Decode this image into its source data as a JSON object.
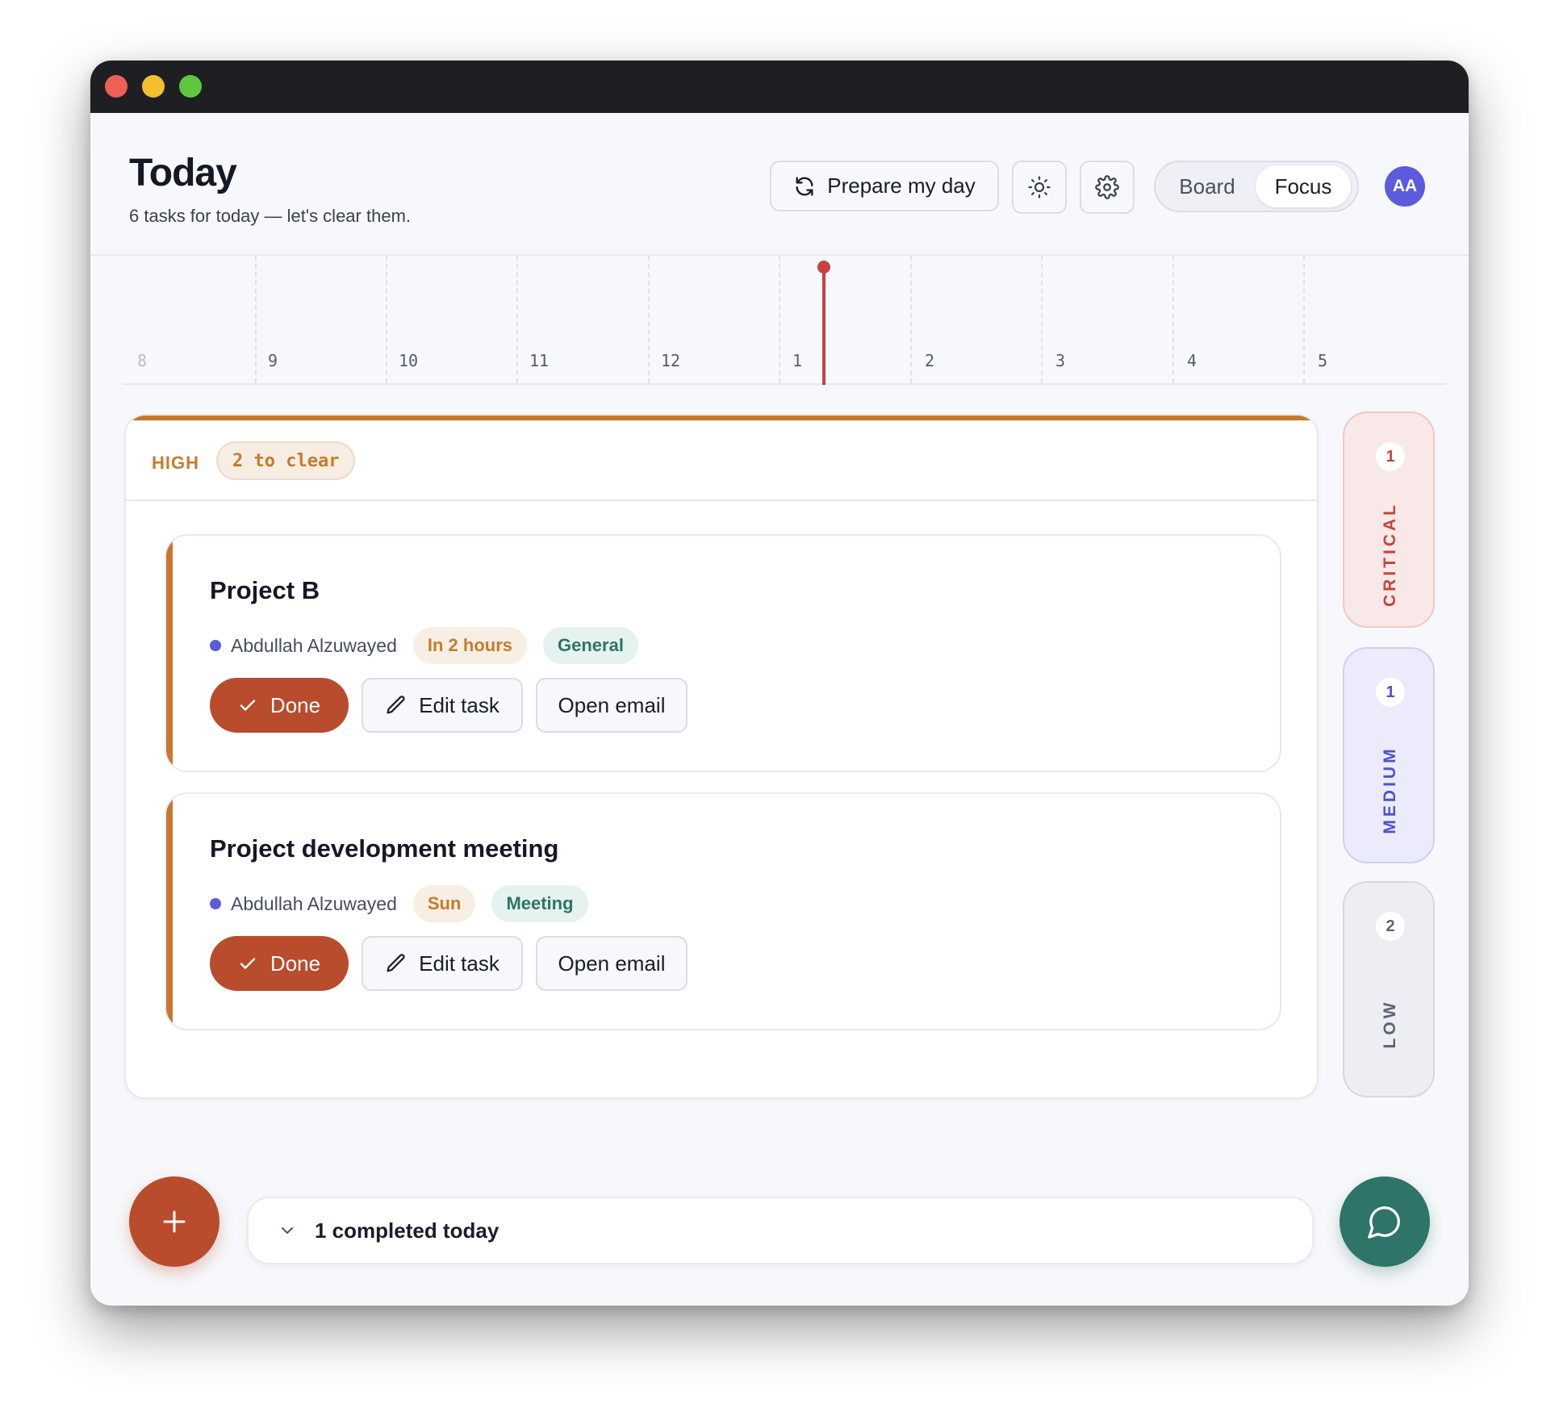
{
  "window": {
    "controls": [
      "close",
      "minimize",
      "maximize"
    ]
  },
  "header": {
    "title": "Today",
    "subtitle": "6 tasks for today — let's clear them.",
    "prepare_label": "Prepare my day",
    "theme_icon": "sun-icon",
    "settings_icon": "gear-icon",
    "view_options": [
      "Board",
      "Focus"
    ],
    "active_view": "Focus",
    "avatar_initials": "AA"
  },
  "timeline": {
    "hours": [
      "8",
      "9",
      "10",
      "11",
      "12",
      "1",
      "2",
      "3",
      "4",
      "5"
    ],
    "now_marker_color": "#c94141"
  },
  "priority_group": {
    "level": "HIGH",
    "count_label": "2 to clear",
    "accent_color": "#c9762f",
    "tasks": [
      {
        "title": "Project B",
        "owner": "Abdullah Alzuwayed",
        "due": "In 2 hours",
        "category": "General",
        "done_label": "Done",
        "edit_label": "Edit task",
        "email_label": "Open email"
      },
      {
        "title": "Project development meeting",
        "owner": "Abdullah Alzuwayed",
        "due": "Sun",
        "category": "Meeting",
        "done_label": "Done",
        "edit_label": "Edit task",
        "email_label": "Open email"
      }
    ]
  },
  "side_filters": [
    {
      "count": "1",
      "label": "CRITICAL",
      "color": "#c2463b"
    },
    {
      "count": "1",
      "label": "MEDIUM",
      "color": "#5151c9"
    },
    {
      "count": "2",
      "label": "LOW",
      "color": "#5c6274"
    }
  ],
  "footer": {
    "completed_label": "1 completed today",
    "add_icon": "plus-icon",
    "chat_icon": "chat-bubble-icon",
    "add_color": "#b84c2c",
    "chat_color": "#2e7468"
  }
}
